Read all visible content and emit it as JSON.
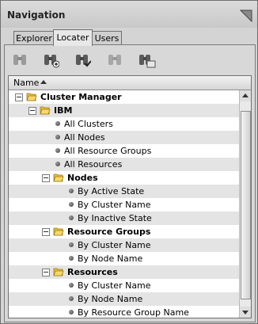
{
  "window": {
    "title": "Navigation",
    "corner_icon": "panel-corner-icon"
  },
  "tabs": [
    {
      "label": "Explorer",
      "active": false
    },
    {
      "label": "Locater",
      "active": true
    },
    {
      "label": "Users",
      "active": false
    }
  ],
  "toolbar": {
    "buttons": [
      {
        "name": "binoculars-icon",
        "enabled": false
      },
      {
        "name": "binoculars-add-icon",
        "enabled": true
      },
      {
        "name": "binoculars-check-icon",
        "enabled": true
      },
      {
        "name": "binoculars-disabled-icon",
        "enabled": false
      },
      {
        "name": "binoculars-folder-icon",
        "enabled": true
      }
    ]
  },
  "tree": {
    "column_header": "Name",
    "rows": [
      {
        "label": "Cluster Manager",
        "level": 0,
        "kind": "folder",
        "bold": true
      },
      {
        "label": "IBM",
        "level": 1,
        "kind": "folder",
        "bold": true
      },
      {
        "label": "All Clusters",
        "level": 2,
        "kind": "leaf",
        "bold": false
      },
      {
        "label": "All Nodes",
        "level": 2,
        "kind": "leaf",
        "bold": false
      },
      {
        "label": "All Resource Groups",
        "level": 2,
        "kind": "leaf",
        "bold": false
      },
      {
        "label": "All Resources",
        "level": 2,
        "kind": "leaf",
        "bold": false
      },
      {
        "label": "Nodes",
        "level": 2,
        "kind": "folder",
        "bold": true
      },
      {
        "label": "By Active State",
        "level": 3,
        "kind": "leaf",
        "bold": false
      },
      {
        "label": "By Cluster Name",
        "level": 3,
        "kind": "leaf",
        "bold": false
      },
      {
        "label": "By Inactive State",
        "level": 3,
        "kind": "leaf",
        "bold": false
      },
      {
        "label": "Resource Groups",
        "level": 2,
        "kind": "folder",
        "bold": true
      },
      {
        "label": "By Cluster Name",
        "level": 3,
        "kind": "leaf",
        "bold": false
      },
      {
        "label": "By Node Name",
        "level": 3,
        "kind": "leaf",
        "bold": false
      },
      {
        "label": "Resources",
        "level": 2,
        "kind": "folder",
        "bold": true
      },
      {
        "label": "By Cluster Name",
        "level": 3,
        "kind": "leaf",
        "bold": false
      },
      {
        "label": "By Node Name",
        "level": 3,
        "kind": "leaf",
        "bold": false
      },
      {
        "label": "By Resource Group Name",
        "level": 3,
        "kind": "leaf",
        "bold": false
      }
    ]
  },
  "colors": {
    "row_alt": "#e4e4e4",
    "folder": "#f4d35e"
  }
}
